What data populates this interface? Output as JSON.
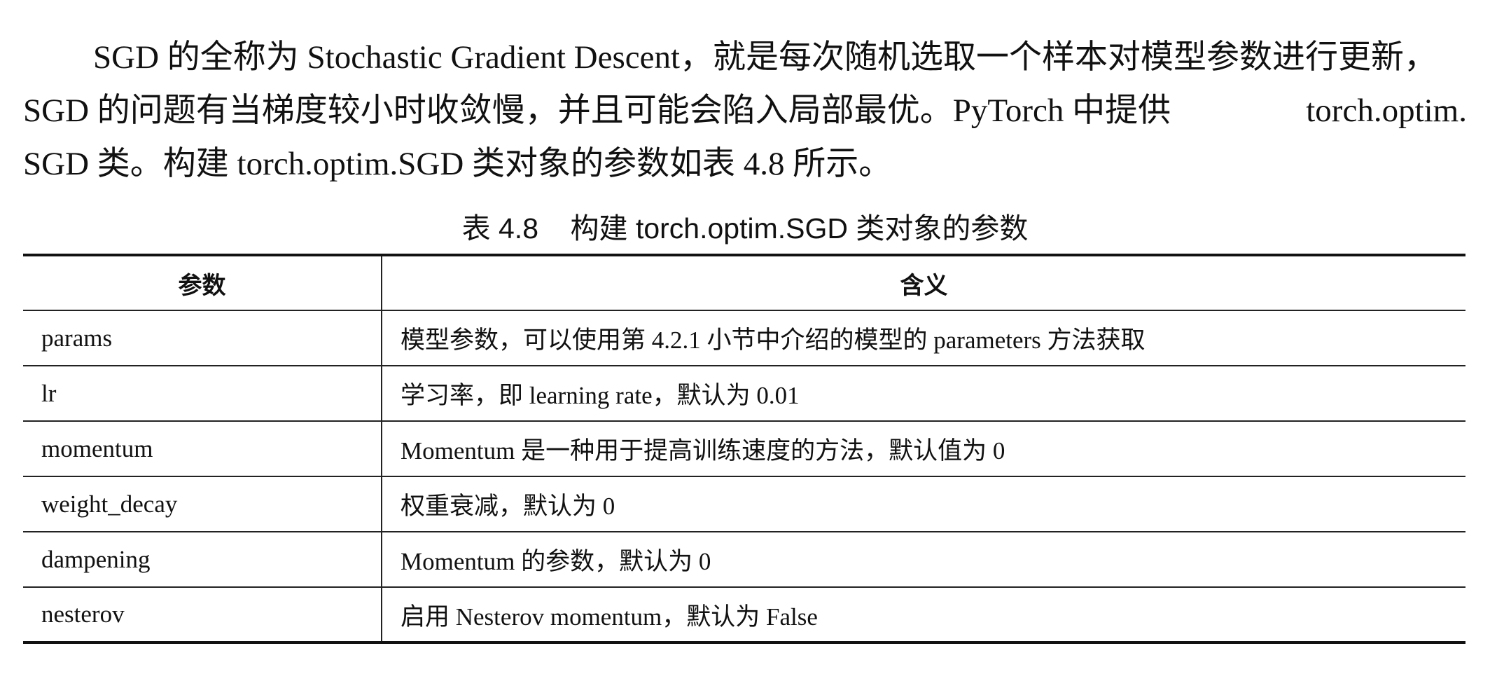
{
  "paragraph": {
    "line1": "SGD 的全称为 Stochastic Gradient Descent，就是每次随机选取一个样本对模型参数进行更新，",
    "line2_left": "SGD 的问题有当梯度较小时收敛慢，并且可能会陷入局部最优。PyTorch 中提供",
    "line2_right": "torch.optim.",
    "line3": "SGD 类。构建 torch.optim.SGD 类对象的参数如表 4.8 所示。"
  },
  "table_caption": "表 4.8    构建 torch.optim.SGD 类对象的参数",
  "table": {
    "headers": [
      "参数",
      "含义"
    ],
    "rows": [
      [
        "params",
        "模型参数，可以使用第 4.2.1 小节中介绍的模型的 parameters 方法获取"
      ],
      [
        "lr",
        "学习率，即 learning rate，默认为 0.01"
      ],
      [
        "momentum",
        "Momentum 是一种用于提高训练速度的方法，默认值为 0"
      ],
      [
        "weight_decay",
        "权重衰减，默认为 0"
      ],
      [
        "dampening",
        "Momentum 的参数，默认为 0"
      ],
      [
        "nesterov",
        "启用 Nesterov momentum，默认为 False"
      ]
    ]
  }
}
